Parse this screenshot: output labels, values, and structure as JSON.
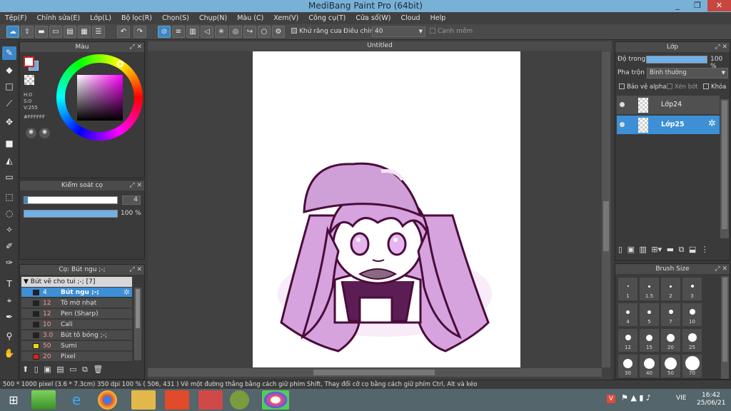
{
  "app": {
    "title": "MediBang Paint Pro (64bit)"
  },
  "window_buttons": {
    "minimize": "_",
    "restore": "❐",
    "close": "✕"
  },
  "menu": [
    "Tệp(F)",
    "Chỉnh sửa(E)",
    "Lớp(L)",
    "Bộ lọc(R)",
    "Chọn(S)",
    "Chụp(N)",
    "Màu (C)",
    "Xem(V)",
    "Công cụ(T)",
    "Cửa sổ(W)",
    "Cloud",
    "Help"
  ],
  "toolbar": {
    "antialias_label": "Khử răng cưa",
    "adjust_label": "Điều chỉnh",
    "adjust_value": "40",
    "soft_edge_label": "Cạnh mềm"
  },
  "color_panel": {
    "title": "Màu",
    "h": "H:0",
    "s": "S:0",
    "v": "V:255",
    "hex": "#FFFFFF",
    "primary_color": "#ffffff",
    "secondary_color": "#6fa8dc"
  },
  "brush_control": {
    "title": "Kiểm soát cọ",
    "size": "4",
    "opacity": "100 %",
    "size_fill": 0.04,
    "opacity_fill": 1.0
  },
  "brush_list": {
    "title": "Cọ: Bút ngu ;-;",
    "group": "Bút vẽ cho tui ;-; [7]",
    "items": [
      {
        "size": "4",
        "name": "Bút ngu ;-;",
        "color": "#222222",
        "selected": true
      },
      {
        "size": "12",
        "name": "Tô mờ nhạt",
        "color": "#222222",
        "selected": false
      },
      {
        "size": "12",
        "name": "Pen (Sharp)",
        "color": "#222222",
        "selected": false
      },
      {
        "size": "10",
        "name": "Cali",
        "color": "#222222",
        "selected": false
      },
      {
        "size": "3.0",
        "name": "Bút tô bóng ;-;",
        "color": "#222222",
        "selected": false
      },
      {
        "size": "50",
        "name": "Sumi",
        "color": "#f0d020",
        "selected": false
      },
      {
        "size": "20",
        "name": "Pixel",
        "color": "#e02020",
        "selected": false
      }
    ]
  },
  "canvas": {
    "title": "Untitled"
  },
  "layer_panel": {
    "title": "Lớp",
    "opacity_label": "Độ trong",
    "opacity_value": "100 %",
    "blend_label": "Pha trộn",
    "blend_value": "Bình thường",
    "protect_alpha": "Bảo vệ alpha",
    "clipping": "Xén bớt",
    "lock": "Khóa",
    "layers": [
      {
        "name": "Lớp24",
        "selected": false
      },
      {
        "name": "Lớp25",
        "selected": true
      }
    ]
  },
  "brush_size_panel": {
    "title": "Brush Size",
    "sizes": [
      "1",
      "1.5",
      "2",
      "3",
      "4",
      "5",
      "7",
      "10",
      "12",
      "15",
      "20",
      "25",
      "30",
      "40",
      "50",
      "70"
    ]
  },
  "status": {
    "text": "500 * 1000 pixel   (3.6 * 7.3cm)   350 dpi   100 %   ( 506, 431 )   Vẽ một đường thẳng bằng cách giữ phím Shift, Thay đổi cỡ cọ bằng cách giữ phím Ctrl, Alt và kéo"
  },
  "taskbar": {
    "lang": "VIE",
    "time": "16:42",
    "date": "25/06/21"
  },
  "colors": {
    "accent": "#3d86c6",
    "titlebar": "#79b0d6",
    "hair": "#d6a3df",
    "outline": "#4a0c3a"
  }
}
